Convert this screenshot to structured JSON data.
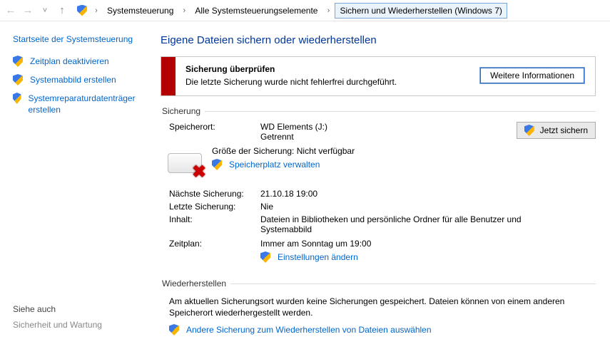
{
  "breadcrumb": {
    "items": [
      "Systemsteuerung",
      "Alle Systemsteuerungselemente",
      "Sichern und Wiederherstellen (Windows 7)"
    ]
  },
  "sidebar": {
    "home": "Startseite der Systemsteuerung",
    "items": [
      {
        "label": "Zeitplan deaktivieren"
      },
      {
        "label": "Systemabbild erstellen"
      },
      {
        "label": "Systemreparaturdatenträger erstellen"
      }
    ],
    "see_also_header": "Siehe auch",
    "see_also_item": "Sicherheit und Wartung"
  },
  "page": {
    "title": "Eigene Dateien sichern oder wiederherstellen"
  },
  "alert": {
    "title": "Sicherung überprüfen",
    "message": "Die letzte Sicherung wurde nicht fehlerfrei durchgeführt.",
    "button": "Weitere Informationen"
  },
  "backup": {
    "section": "Sicherung",
    "backup_now": "Jetzt sichern",
    "location_label": "Speicherort:",
    "location_value": "WD Elements (J:)",
    "location_status": "Getrennt",
    "size_label": "Größe der Sicherung:",
    "size_value": "Nicht verfügbar",
    "manage_space": "Speicherplatz verwalten",
    "next_label": "Nächste Sicherung:",
    "next_value": "21.10.18 19:00",
    "last_label": "Letzte Sicherung:",
    "last_value": "Nie",
    "content_label": "Inhalt:",
    "content_value": "Dateien in Bibliotheken und persönliche Ordner für alle Benutzer und Systemabbild",
    "schedule_label": "Zeitplan:",
    "schedule_value": "Immer am Sonntag um 19:00",
    "change_settings": "Einstellungen ändern"
  },
  "restore": {
    "section": "Wiederherstellen",
    "para": "Am aktuellen Sicherungsort wurden keine Sicherungen gespeichert. Dateien können von einem anderen Speicherort wiederhergestellt werden.",
    "other_backup": "Andere Sicherung zum Wiederherstellen von Dateien auswählen"
  }
}
